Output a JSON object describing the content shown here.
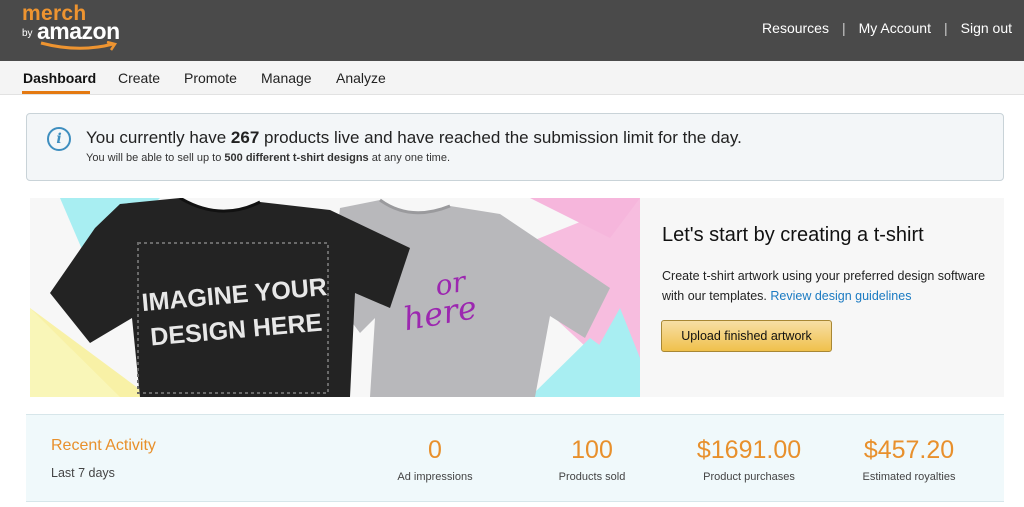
{
  "brand": {
    "merch": "merch",
    "by": "by",
    "amazon": "amazon"
  },
  "header": {
    "links": [
      "Resources",
      "My Account",
      "Sign out"
    ]
  },
  "nav": {
    "tabs": [
      "Dashboard",
      "Create",
      "Promote",
      "Manage",
      "Analyze"
    ],
    "active": "Dashboard"
  },
  "alert": {
    "main_prefix": "You currently have ",
    "main_count": "267",
    "main_suffix": " products live and have reached the submission limit for the day.",
    "sub_prefix": "You will be able to sell up to ",
    "sub_bold": "500 different t-shirt designs",
    "sub_suffix": " at any one time."
  },
  "hero": {
    "shirt_black_text_1": "IMAGINE YOUR",
    "shirt_black_text_2": "DESIGN HERE",
    "shirt_grey_text_1": "or",
    "shirt_grey_text_2": "here",
    "title": "Let's start by creating a t-shirt",
    "desc": "Create t-shirt artwork using your preferred design software with our templates. ",
    "link": "Review design guidelines",
    "button": "Upload finished artwork"
  },
  "activity": {
    "title": "Recent Activity",
    "period": "Last 7 days",
    "metrics": [
      {
        "value": "0",
        "label": "Ad impressions"
      },
      {
        "value": "100",
        "label": "Products sold"
      },
      {
        "value": "$1691.00",
        "label": "Product purchases"
      },
      {
        "value": "$457.20",
        "label": "Estimated royalties"
      }
    ]
  },
  "colors": {
    "accent": "#e47911",
    "brand_orange": "#ee9430",
    "link": "#1a7ac2",
    "header_bg": "#4a4a4a"
  },
  "icons": {
    "info": "info-icon"
  }
}
